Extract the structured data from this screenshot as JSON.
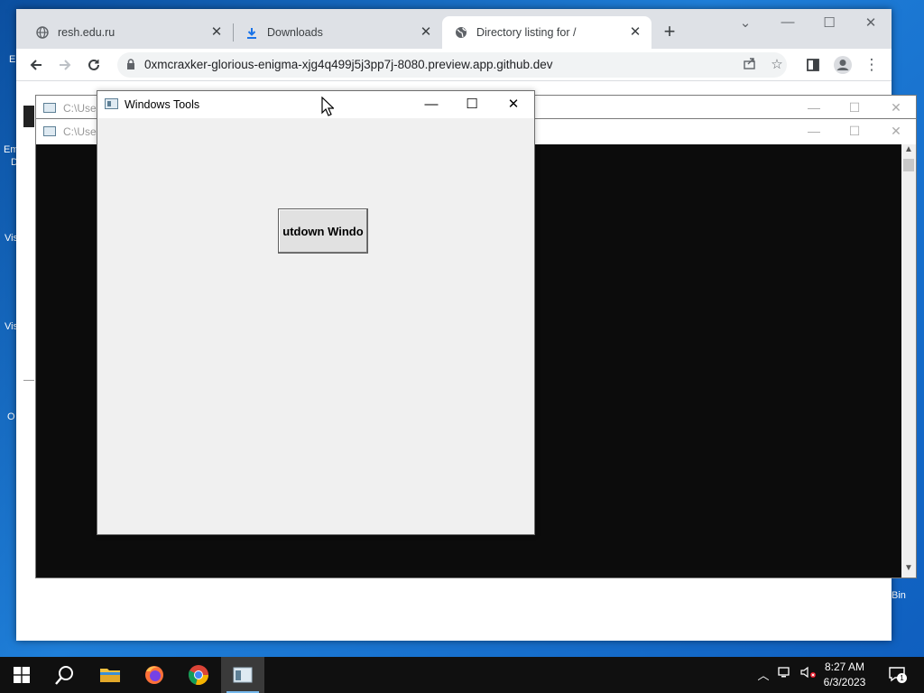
{
  "desktop": {
    "icon_labels": [
      "E",
      "Em",
      "D",
      "Vis",
      "Vis",
      "O",
      "Bin"
    ]
  },
  "browser": {
    "tabs": [
      {
        "title": "resh.edu.ru",
        "icon": "globe-icon",
        "active": false
      },
      {
        "title": "Downloads",
        "icon": "download-icon",
        "active": false
      },
      {
        "title": "Directory listing for /",
        "icon": "globe-icon",
        "active": true
      }
    ],
    "url": "0xmcraxker-glorious-enigma-xjg4q499j5j3pp7j-8080.preview.app.github.dev"
  },
  "consoles": [
    {
      "title": "C:\\User"
    },
    {
      "title": "C:\\User"
    }
  ],
  "tools_window": {
    "title": "Windows Tools",
    "button_label": "utdown Windo"
  },
  "taskbar": {
    "time": "8:27 AM",
    "date": "6/3/2023",
    "notification_count": "1"
  },
  "colors": {
    "accent": "#76b9ed",
    "taskbar": "#101010",
    "desktop": "#1f7fd9"
  }
}
